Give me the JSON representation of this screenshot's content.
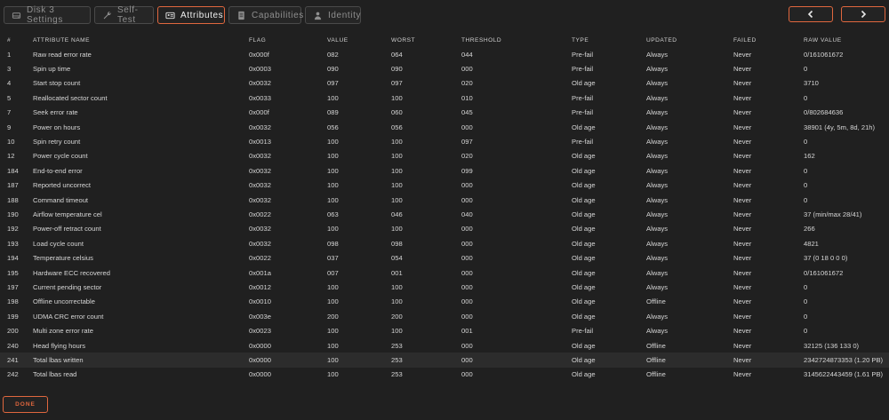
{
  "tabs": [
    {
      "label": "Disk 3 Settings",
      "icon": "disk-icon",
      "active": false
    },
    {
      "label": "Self-Test",
      "icon": "wrench-icon",
      "active": false
    },
    {
      "label": "Attributes",
      "icon": "id-card-icon",
      "active": true
    },
    {
      "label": "Capabilities",
      "icon": "document-icon",
      "active": false
    },
    {
      "label": "Identity",
      "icon": "person-icon",
      "active": false
    }
  ],
  "nav": {
    "prev_icon": "chevron-left-icon",
    "next_icon": "chevron-right-icon"
  },
  "accent_color": "#e0673e",
  "table": {
    "headers": {
      "id": "#",
      "name": "ATTRIBUTE NAME",
      "flag": "FLAG",
      "value": "VALUE",
      "worst": "WORST",
      "threshold": "THRESHOLD",
      "type": "TYPE",
      "updated": "UPDATED",
      "failed": "FAILED",
      "raw": "RAW VALUE"
    },
    "rows": [
      {
        "id": "1",
        "name": "Raw read error rate",
        "flag": "0x000f",
        "value": "082",
        "worst": "064",
        "threshold": "044",
        "type": "Pre-fail",
        "updated": "Always",
        "failed": "Never",
        "raw": "0/161061672"
      },
      {
        "id": "3",
        "name": "Spin up time",
        "flag": "0x0003",
        "value": "090",
        "worst": "090",
        "threshold": "000",
        "type": "Pre-fail",
        "updated": "Always",
        "failed": "Never",
        "raw": "0"
      },
      {
        "id": "4",
        "name": "Start stop count",
        "flag": "0x0032",
        "value": "097",
        "worst": "097",
        "threshold": "020",
        "type": "Old age",
        "updated": "Always",
        "failed": "Never",
        "raw": "3710"
      },
      {
        "id": "5",
        "name": "Reallocated sector count",
        "flag": "0x0033",
        "value": "100",
        "worst": "100",
        "threshold": "010",
        "type": "Pre-fail",
        "updated": "Always",
        "failed": "Never",
        "raw": "0"
      },
      {
        "id": "7",
        "name": "Seek error rate",
        "flag": "0x000f",
        "value": "089",
        "worst": "060",
        "threshold": "045",
        "type": "Pre-fail",
        "updated": "Always",
        "failed": "Never",
        "raw": "0/802684636"
      },
      {
        "id": "9",
        "name": "Power on hours",
        "flag": "0x0032",
        "value": "056",
        "worst": "056",
        "threshold": "000",
        "type": "Old age",
        "updated": "Always",
        "failed": "Never",
        "raw": "38901 (4y, 5m, 8d, 21h)"
      },
      {
        "id": "10",
        "name": "Spin retry count",
        "flag": "0x0013",
        "value": "100",
        "worst": "100",
        "threshold": "097",
        "type": "Pre-fail",
        "updated": "Always",
        "failed": "Never",
        "raw": "0"
      },
      {
        "id": "12",
        "name": "Power cycle count",
        "flag": "0x0032",
        "value": "100",
        "worst": "100",
        "threshold": "020",
        "type": "Old age",
        "updated": "Always",
        "failed": "Never",
        "raw": "162"
      },
      {
        "id": "184",
        "name": "End-to-end error",
        "flag": "0x0032",
        "value": "100",
        "worst": "100",
        "threshold": "099",
        "type": "Old age",
        "updated": "Always",
        "failed": "Never",
        "raw": "0"
      },
      {
        "id": "187",
        "name": "Reported uncorrect",
        "flag": "0x0032",
        "value": "100",
        "worst": "100",
        "threshold": "000",
        "type": "Old age",
        "updated": "Always",
        "failed": "Never",
        "raw": "0"
      },
      {
        "id": "188",
        "name": "Command timeout",
        "flag": "0x0032",
        "value": "100",
        "worst": "100",
        "threshold": "000",
        "type": "Old age",
        "updated": "Always",
        "failed": "Never",
        "raw": "0"
      },
      {
        "id": "190",
        "name": "Airflow temperature cel",
        "flag": "0x0022",
        "value": "063",
        "worst": "046",
        "threshold": "040",
        "type": "Old age",
        "updated": "Always",
        "failed": "Never",
        "raw": "37 (min/max 28/41)"
      },
      {
        "id": "192",
        "name": "Power-off retract count",
        "flag": "0x0032",
        "value": "100",
        "worst": "100",
        "threshold": "000",
        "type": "Old age",
        "updated": "Always",
        "failed": "Never",
        "raw": "266"
      },
      {
        "id": "193",
        "name": "Load cycle count",
        "flag": "0x0032",
        "value": "098",
        "worst": "098",
        "threshold": "000",
        "type": "Old age",
        "updated": "Always",
        "failed": "Never",
        "raw": "4821"
      },
      {
        "id": "194",
        "name": "Temperature celsius",
        "flag": "0x0022",
        "value": "037",
        "worst": "054",
        "threshold": "000",
        "type": "Old age",
        "updated": "Always",
        "failed": "Never",
        "raw": "37 (0 18 0 0 0)"
      },
      {
        "id": "195",
        "name": "Hardware ECC recovered",
        "flag": "0x001a",
        "value": "007",
        "worst": "001",
        "threshold": "000",
        "type": "Old age",
        "updated": "Always",
        "failed": "Never",
        "raw": "0/161061672"
      },
      {
        "id": "197",
        "name": "Current pending sector",
        "flag": "0x0012",
        "value": "100",
        "worst": "100",
        "threshold": "000",
        "type": "Old age",
        "updated": "Always",
        "failed": "Never",
        "raw": "0"
      },
      {
        "id": "198",
        "name": "Offline uncorrectable",
        "flag": "0x0010",
        "value": "100",
        "worst": "100",
        "threshold": "000",
        "type": "Old age",
        "updated": "Offline",
        "failed": "Never",
        "raw": "0"
      },
      {
        "id": "199",
        "name": "UDMA CRC error count",
        "flag": "0x003e",
        "value": "200",
        "worst": "200",
        "threshold": "000",
        "type": "Old age",
        "updated": "Always",
        "failed": "Never",
        "raw": "0"
      },
      {
        "id": "200",
        "name": "Multi zone error rate",
        "flag": "0x0023",
        "value": "100",
        "worst": "100",
        "threshold": "001",
        "type": "Pre-fail",
        "updated": "Always",
        "failed": "Never",
        "raw": "0"
      },
      {
        "id": "240",
        "name": "Head flying hours",
        "flag": "0x0000",
        "value": "100",
        "worst": "253",
        "threshold": "000",
        "type": "Old age",
        "updated": "Offline",
        "failed": "Never",
        "raw": "32125 (136 133 0)"
      },
      {
        "id": "241",
        "name": "Total lbas written",
        "flag": "0x0000",
        "value": "100",
        "worst": "253",
        "threshold": "000",
        "type": "Old age",
        "updated": "Offline",
        "failed": "Never",
        "raw": "2342724873353 (1.20 PB)",
        "highlight": true
      },
      {
        "id": "242",
        "name": "Total lbas read",
        "flag": "0x0000",
        "value": "100",
        "worst": "253",
        "threshold": "000",
        "type": "Old age",
        "updated": "Offline",
        "failed": "Never",
        "raw": "3145622443459 (1.61 PB)"
      }
    ]
  },
  "done_label": "DONE"
}
